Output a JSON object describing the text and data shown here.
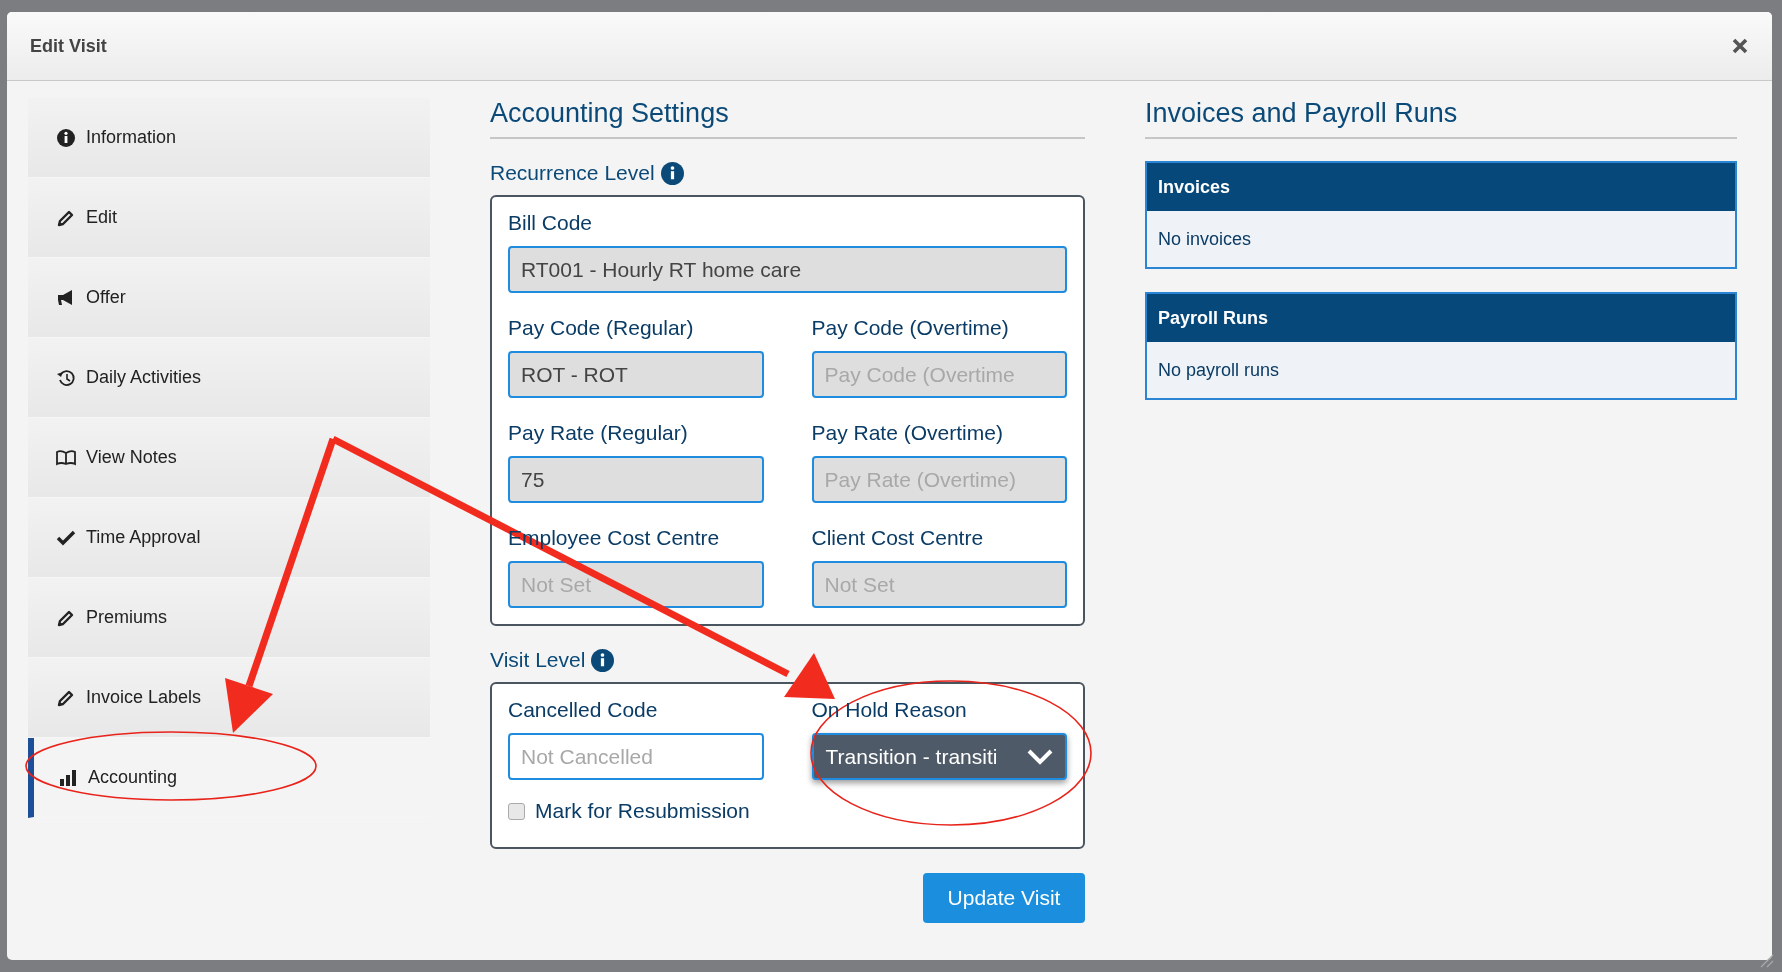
{
  "dialog": {
    "title": "Edit Visit"
  },
  "sidebar": {
    "items": [
      {
        "label": "Information",
        "selected": false
      },
      {
        "label": "Edit",
        "selected": false
      },
      {
        "label": "Offer",
        "selected": false
      },
      {
        "label": "Daily Activities",
        "selected": false
      },
      {
        "label": "View Notes",
        "selected": false
      },
      {
        "label": "Time Approval",
        "selected": false
      },
      {
        "label": "Premiums",
        "selected": false
      },
      {
        "label": "Invoice Labels",
        "selected": false
      },
      {
        "label": "Accounting",
        "selected": true
      }
    ]
  },
  "accounting": {
    "title": "Accounting Settings",
    "recurrence_level": {
      "title": "Recurrence Level",
      "fields": [
        {
          "label": "Bill Code",
          "value": "RT001 - Hourly RT home care",
          "disabled": true
        },
        {
          "label": "Pay Code (Regular)",
          "value": "ROT - ROT",
          "disabled": true
        },
        {
          "label": "Pay Code (Overtime)",
          "placeholder": "Pay Code (Overtime",
          "disabled": true
        },
        {
          "label": "Pay Rate (Regular)",
          "value": "75",
          "disabled": true
        },
        {
          "label": "Pay Rate (Overtime)",
          "placeholder": "Pay Rate (Overtime)",
          "disabled": true
        },
        {
          "label": "Employee Cost Centre",
          "placeholder": "Not Set",
          "disabled": true
        },
        {
          "label": "Client Cost Centre",
          "placeholder": "Not Set",
          "disabled": true
        }
      ]
    },
    "visit_level": {
      "title": "Visit Level",
      "fields": [
        {
          "kind": "input",
          "label": "Cancelled Code",
          "placeholder": "Not Cancelled",
          "disabled": false
        },
        {
          "kind": "select",
          "label": "On Hold Reason",
          "value": "Transition - transiti"
        }
      ],
      "checkbox": {
        "label": "Mark for Resubmission",
        "checked": false
      }
    },
    "button": "Update Visit"
  },
  "invoices_and_payroll": {
    "title": "Invoices and Payroll Runs",
    "panels": [
      {
        "title": "Invoices",
        "body": "No invoices"
      },
      {
        "title": "Payroll Runs",
        "body": "No payroll runs"
      }
    ]
  }
}
